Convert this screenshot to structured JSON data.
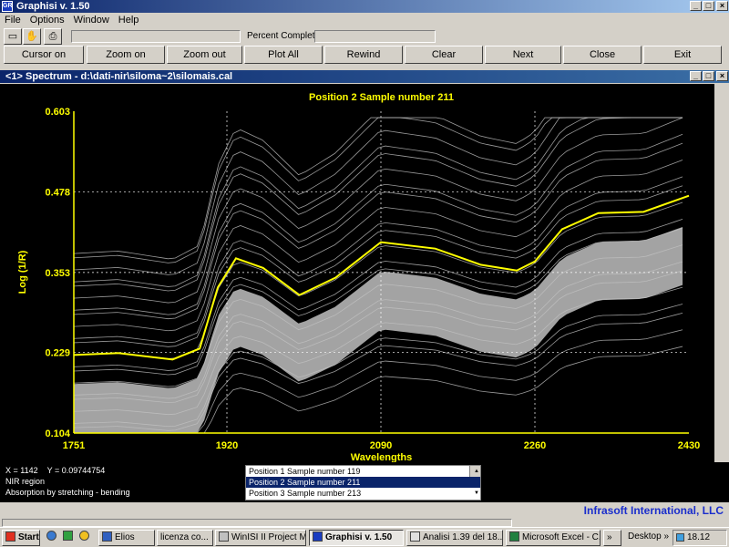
{
  "window": {
    "title": "Graphisi v. 1.50",
    "icon_text": "GR"
  },
  "menu": [
    "File",
    "Options",
    "Window",
    "Help"
  ],
  "toolbar": {
    "percent_label": "Percent Complete:"
  },
  "buttons": [
    "Cursor on",
    "Zoom on",
    "Zoom out",
    "Plot All",
    "Rewind",
    "Clear",
    "Next",
    "Close",
    "Exit"
  ],
  "child": {
    "title": "<1> Spectrum - d:\\dati-nir\\siloma~2\\silomais.cal"
  },
  "chart_data": {
    "type": "line",
    "title": "Position 2  Sample number 211",
    "xlabel": "Wavelengths",
    "ylabel": "Log (1/R)",
    "xlim": [
      1751,
      2430
    ],
    "ylim": [
      0.104,
      0.603
    ],
    "x_ticks": [
      "1751",
      "1920",
      "2090",
      "2260",
      "2430"
    ],
    "y_ticks": [
      "0.104",
      "0.229",
      "0.353",
      "0.478",
      "0.603"
    ],
    "grid": true,
    "highlight_series": {
      "name": "Sample number 211",
      "color": "#ffff00",
      "x": [
        1751,
        1800,
        1860,
        1890,
        1910,
        1930,
        1960,
        2000,
        2040,
        2090,
        2150,
        2200,
        2240,
        2260,
        2290,
        2330,
        2380,
        2430
      ],
      "y": [
        0.225,
        0.228,
        0.218,
        0.235,
        0.33,
        0.375,
        0.36,
        0.318,
        0.345,
        0.4,
        0.39,
        0.365,
        0.356,
        0.37,
        0.42,
        0.445,
        0.447,
        0.472
      ]
    },
    "background_series_color": "#c0c0c0"
  },
  "info": {
    "x_label": "X = 1142",
    "y_label": "Y = 0.09744754",
    "line2": "NIR region",
    "line3": "Absorption by stretching - bending"
  },
  "list": [
    "Position 1  Sample number 119",
    "Position 2  Sample number 211",
    "Position 3  Sample number 213"
  ],
  "list_selected": 1,
  "brand": "Infrasoft International, LLC",
  "taskbar": {
    "start": "Start",
    "items": [
      "Elios",
      "licenza co...",
      "WinISI II Project M...",
      "Graphisi v. 1.50",
      "Analisi  1.39 del 18...",
      "Microsoft Excel - C..."
    ],
    "desktop": "Desktop",
    "time": "18.12"
  },
  "colors": {
    "title_start": "#0a246a",
    "title_end": "#a6caf0",
    "axis": "#ffff00",
    "brand": "#1a2ecc"
  }
}
